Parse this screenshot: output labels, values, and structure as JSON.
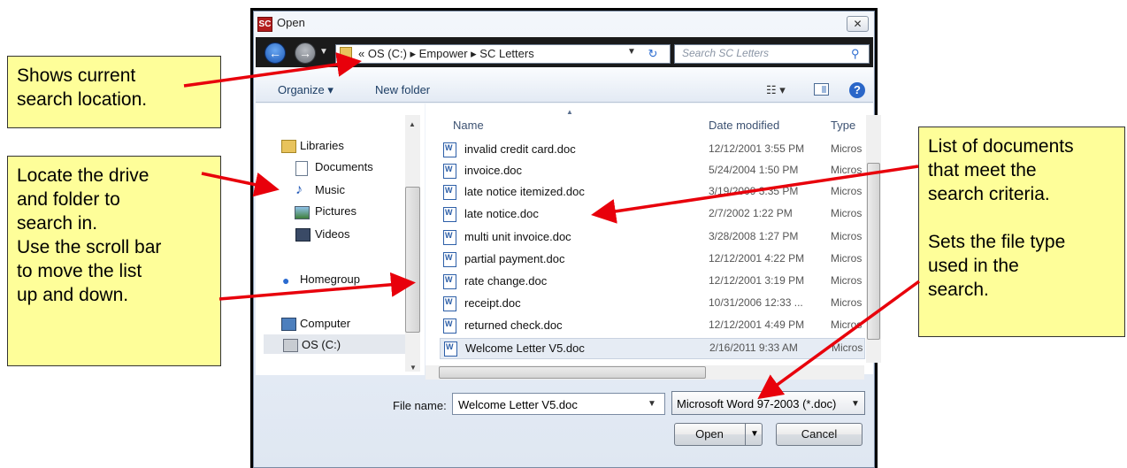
{
  "window": {
    "title": "Open",
    "app_icon_text": "SC",
    "close_label": "✕"
  },
  "address_bar": {
    "path": "« OS (C:) ▸ Empower ▸ SC Letters",
    "search_placeholder": "Search SC Letters"
  },
  "toolbar": {
    "organize_label": "Organize ▾",
    "new_folder_label": "New folder",
    "views_label": "☷ ▾",
    "help_label": "?"
  },
  "nav": {
    "libraries": "Libraries",
    "documents": "Documents",
    "music": "Music",
    "pictures": "Pictures",
    "videos": "Videos",
    "homegroup": "Homegroup",
    "computer": "Computer",
    "drive": "OS (C:)"
  },
  "columns": {
    "name": "Name",
    "date_modified": "Date modified",
    "type": "Type"
  },
  "files": [
    {
      "name": "invalid credit card.doc",
      "date": "12/12/2001 3:55 PM",
      "type": "Micros"
    },
    {
      "name": "invoice.doc",
      "date": "5/24/2004 1:50 PM",
      "type": "Micros"
    },
    {
      "name": "late notice itemized.doc",
      "date": "3/19/2009 3:35 PM",
      "type": "Micros"
    },
    {
      "name": "late notice.doc",
      "date": "2/7/2002 1:22 PM",
      "type": "Micros"
    },
    {
      "name": "multi unit invoice.doc",
      "date": "3/28/2008 1:27 PM",
      "type": "Micros"
    },
    {
      "name": "partial payment.doc",
      "date": "12/12/2001 4:22 PM",
      "type": "Micros"
    },
    {
      "name": "rate change.doc",
      "date": "12/12/2001 3:19 PM",
      "type": "Micros"
    },
    {
      "name": "receipt.doc",
      "date": "10/31/2006 12:33 ...",
      "type": "Micros"
    },
    {
      "name": "returned check.doc",
      "date": "12/12/2001 4:49 PM",
      "type": "Micros"
    },
    {
      "name": "Welcome Letter V5.doc",
      "date": "2/16/2011 9:33 AM",
      "type": "Micros"
    }
  ],
  "bottom": {
    "file_name_label": "File name:",
    "file_name_value": "Welcome Letter V5.doc",
    "file_type_value": "Microsoft Word 97-2003 (*.doc)",
    "open_label": "Open",
    "cancel_label": "Cancel"
  },
  "callouts": {
    "location": [
      "Shows current",
      "search location."
    ],
    "drive": [
      "Locate the drive",
      "and folder to",
      "search in.",
      "Use the scroll bar",
      "to move the list",
      "up and down."
    ],
    "documents": [
      "List of documents",
      "that meet the",
      "search criteria."
    ],
    "filetype": [
      "Sets the file type",
      "used in the",
      "search."
    ]
  },
  "colors": {
    "callout_fill": "#fefe99",
    "arrow": "#e8000b",
    "selected_row": "#e6ecf4"
  }
}
